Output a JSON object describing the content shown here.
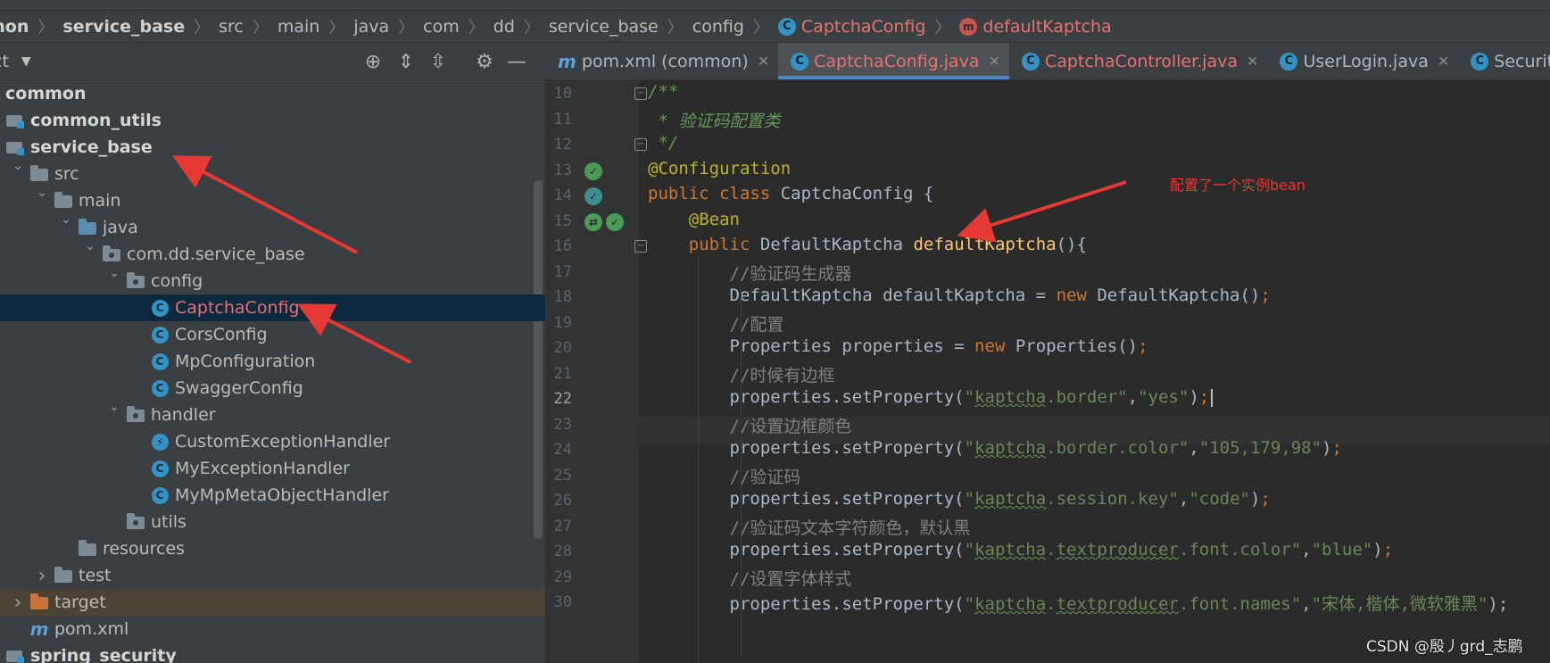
{
  "breadcrumb": [
    "mon",
    "service_base",
    "src",
    "main",
    "java",
    "com",
    "dd",
    "service_base",
    "config",
    "CaptchaConfig",
    "defaultKaptcha"
  ],
  "project": {
    "title": "ct",
    "dropdown": "▼"
  },
  "toolbar_icons": [
    "locate-icon",
    "expand-all-icon",
    "collapse-all-icon",
    "gear-icon",
    "minimize-icon"
  ],
  "tree": [
    {
      "label": "common",
      "indent": 0,
      "icon": "none",
      "arrow": "",
      "bold": true,
      "state": ""
    },
    {
      "label": "common_utils",
      "indent": 0,
      "icon": "module",
      "arrow": "",
      "bold": true,
      "state": ""
    },
    {
      "label": "service_base",
      "indent": 0,
      "icon": "module",
      "arrow": "",
      "bold": true,
      "state": ""
    },
    {
      "label": "src",
      "indent": 1,
      "icon": "folder",
      "arrow": "⌄",
      "bold": false,
      "state": ""
    },
    {
      "label": "main",
      "indent": 2,
      "icon": "folder",
      "arrow": "⌄",
      "bold": false,
      "state": ""
    },
    {
      "label": "java",
      "indent": 3,
      "icon": "folder-blue",
      "arrow": "⌄",
      "bold": false,
      "state": ""
    },
    {
      "label": "com.dd.service_base",
      "indent": 4,
      "icon": "package",
      "arrow": "⌄",
      "bold": false,
      "state": ""
    },
    {
      "label": "config",
      "indent": 5,
      "icon": "package",
      "arrow": "⌄",
      "bold": false,
      "state": ""
    },
    {
      "label": "CaptchaConfig",
      "indent": 6,
      "icon": "class",
      "arrow": "",
      "bold": false,
      "state": "selected"
    },
    {
      "label": "CorsConfig",
      "indent": 6,
      "icon": "class",
      "arrow": "",
      "bold": false,
      "state": ""
    },
    {
      "label": "MpConfiguration",
      "indent": 6,
      "icon": "class",
      "arrow": "",
      "bold": false,
      "state": ""
    },
    {
      "label": "SwaggerConfig",
      "indent": 6,
      "icon": "class",
      "arrow": "",
      "bold": false,
      "state": ""
    },
    {
      "label": "handler",
      "indent": 5,
      "icon": "package",
      "arrow": "⌄",
      "bold": false,
      "state": ""
    },
    {
      "label": "CustomExceptionHandler",
      "indent": 6,
      "icon": "class-bolt",
      "arrow": "",
      "bold": false,
      "state": ""
    },
    {
      "label": "MyExceptionHandler",
      "indent": 6,
      "icon": "class",
      "arrow": "",
      "bold": false,
      "state": ""
    },
    {
      "label": "MyMpMetaObjectHandler",
      "indent": 6,
      "icon": "class",
      "arrow": "",
      "bold": false,
      "state": ""
    },
    {
      "label": "utils",
      "indent": 5,
      "icon": "package",
      "arrow": "",
      "bold": false,
      "state": ""
    },
    {
      "label": "resources",
      "indent": 3,
      "icon": "folder-res",
      "arrow": "",
      "bold": false,
      "state": ""
    },
    {
      "label": "test",
      "indent": 2,
      "icon": "folder",
      "arrow": "›",
      "bold": false,
      "state": ""
    },
    {
      "label": "target",
      "indent": 1,
      "icon": "folder-orange",
      "arrow": "›",
      "bold": false,
      "state": "excluded"
    },
    {
      "label": "pom.xml",
      "indent": 1,
      "icon": "maven",
      "arrow": "",
      "bold": false,
      "state": ""
    },
    {
      "label": "spring_security",
      "indent": 0,
      "icon": "module",
      "arrow": "",
      "bold": true,
      "state": ""
    }
  ],
  "tabs": [
    {
      "label": "pom.xml (common)",
      "icon": "m",
      "active": false,
      "red": false
    },
    {
      "label": "CaptchaConfig.java",
      "icon": "c",
      "active": true,
      "red": true
    },
    {
      "label": "CaptchaController.java",
      "icon": "c",
      "active": false,
      "red": true
    },
    {
      "label": "UserLogin.java",
      "icon": "c",
      "active": false,
      "red": false
    },
    {
      "label": "SecurityConfig",
      "icon": "c",
      "active": false,
      "red": false
    }
  ],
  "line_numbers": [
    "10",
    "11",
    "12",
    "13",
    "14",
    "15",
    "16",
    "17",
    "18",
    "19",
    "20",
    "21",
    "22",
    "23",
    "24",
    "25",
    "26",
    "27",
    "28",
    "29",
    "30"
  ],
  "current_line": "22",
  "code": [
    [
      [
        "doc",
        "/**"
      ]
    ],
    [
      [
        "doc",
        " * 验证码配置类"
      ]
    ],
    [
      [
        "doc",
        " */"
      ]
    ],
    [
      [
        "ann",
        "@Configuration"
      ]
    ],
    [
      [
        "kw",
        "public class "
      ],
      [
        "",
        "CaptchaConfig {"
      ]
    ],
    [
      [
        "",
        "    "
      ],
      [
        "ann",
        "@Bean"
      ]
    ],
    [
      [
        "",
        "    "
      ],
      [
        "kw",
        "public "
      ],
      [
        "",
        "DefaultKaptcha "
      ],
      [
        "fn",
        "defaultKaptcha"
      ],
      [
        "",
        "(){"
      ]
    ],
    [
      [
        "",
        "        "
      ],
      [
        "cmt",
        "//验证码生成器"
      ]
    ],
    [
      [
        "",
        "        DefaultKaptcha defaultKaptcha = "
      ],
      [
        "kw",
        "new "
      ],
      [
        "",
        "DefaultKaptcha()"
      ],
      [
        "kw",
        ";"
      ]
    ],
    [
      [
        "",
        "        "
      ],
      [
        "cmt",
        "//配置"
      ]
    ],
    [
      [
        "",
        "        Properties properties = "
      ],
      [
        "kw",
        "new "
      ],
      [
        "",
        "Properties()"
      ],
      [
        "kw",
        ";"
      ]
    ],
    [
      [
        "",
        "        "
      ],
      [
        "cmt",
        "//时候有边框"
      ]
    ],
    [
      [
        "",
        "        properties.setProperty("
      ],
      [
        "str",
        "\""
      ],
      [
        "squig",
        "kaptcha"
      ],
      [
        "str",
        ".border\""
      ],
      [
        "",
        ","
      ],
      [
        "str",
        "\"yes\""
      ],
      [
        "",
        ")"
      ],
      [
        "kw",
        ";"
      ]
    ],
    [
      [
        "",
        "        "
      ],
      [
        "cmt",
        "//设置边框颜色"
      ]
    ],
    [
      [
        "",
        "        properties.setProperty("
      ],
      [
        "str",
        "\""
      ],
      [
        "squig",
        "kaptcha"
      ],
      [
        "str",
        ".border.color\""
      ],
      [
        "",
        ","
      ],
      [
        "str",
        "\"105,179,98\""
      ],
      [
        "",
        ")"
      ],
      [
        "kw",
        ";"
      ]
    ],
    [
      [
        "",
        "        "
      ],
      [
        "cmt",
        "//验证码"
      ]
    ],
    [
      [
        "",
        "        properties.setProperty("
      ],
      [
        "str",
        "\""
      ],
      [
        "squig",
        "kaptcha"
      ],
      [
        "str",
        ".session.key\""
      ],
      [
        "",
        ","
      ],
      [
        "str",
        "\"code\""
      ],
      [
        "",
        ")"
      ],
      [
        "kw",
        ";"
      ]
    ],
    [
      [
        "",
        "        "
      ],
      [
        "cmt",
        "//验证码文本字符颜色，默认黑"
      ]
    ],
    [
      [
        "",
        "        properties.setProperty("
      ],
      [
        "str",
        "\""
      ],
      [
        "squig",
        "kaptcha"
      ],
      [
        "str",
        "."
      ],
      [
        "squig",
        "textproducer"
      ],
      [
        "str",
        ".font.color\""
      ],
      [
        "",
        ","
      ],
      [
        "str",
        "\"blue\""
      ],
      [
        "",
        ")"
      ],
      [
        "kw",
        ";"
      ]
    ],
    [
      [
        "",
        "        "
      ],
      [
        "cmt",
        "//设置字体样式"
      ]
    ],
    [
      [
        "",
        "        properties.setProperty("
      ],
      [
        "str",
        "\""
      ],
      [
        "squig",
        "kaptcha"
      ],
      [
        "str",
        "."
      ],
      [
        "squig",
        "textproducer"
      ],
      [
        "str",
        ".font.names\""
      ],
      [
        "",
        ","
      ],
      [
        "str",
        "\"宋体,楷体,微软雅黑\""
      ],
      [
        "",
        ");"
      ]
    ]
  ],
  "annotation": "配置了一个实例bean",
  "watermark": "CSDN @殷丿grd_志鹏",
  "colors": {
    "accent": "#4a88c7",
    "selection": "#0d293e",
    "arrow": "#e53935"
  }
}
